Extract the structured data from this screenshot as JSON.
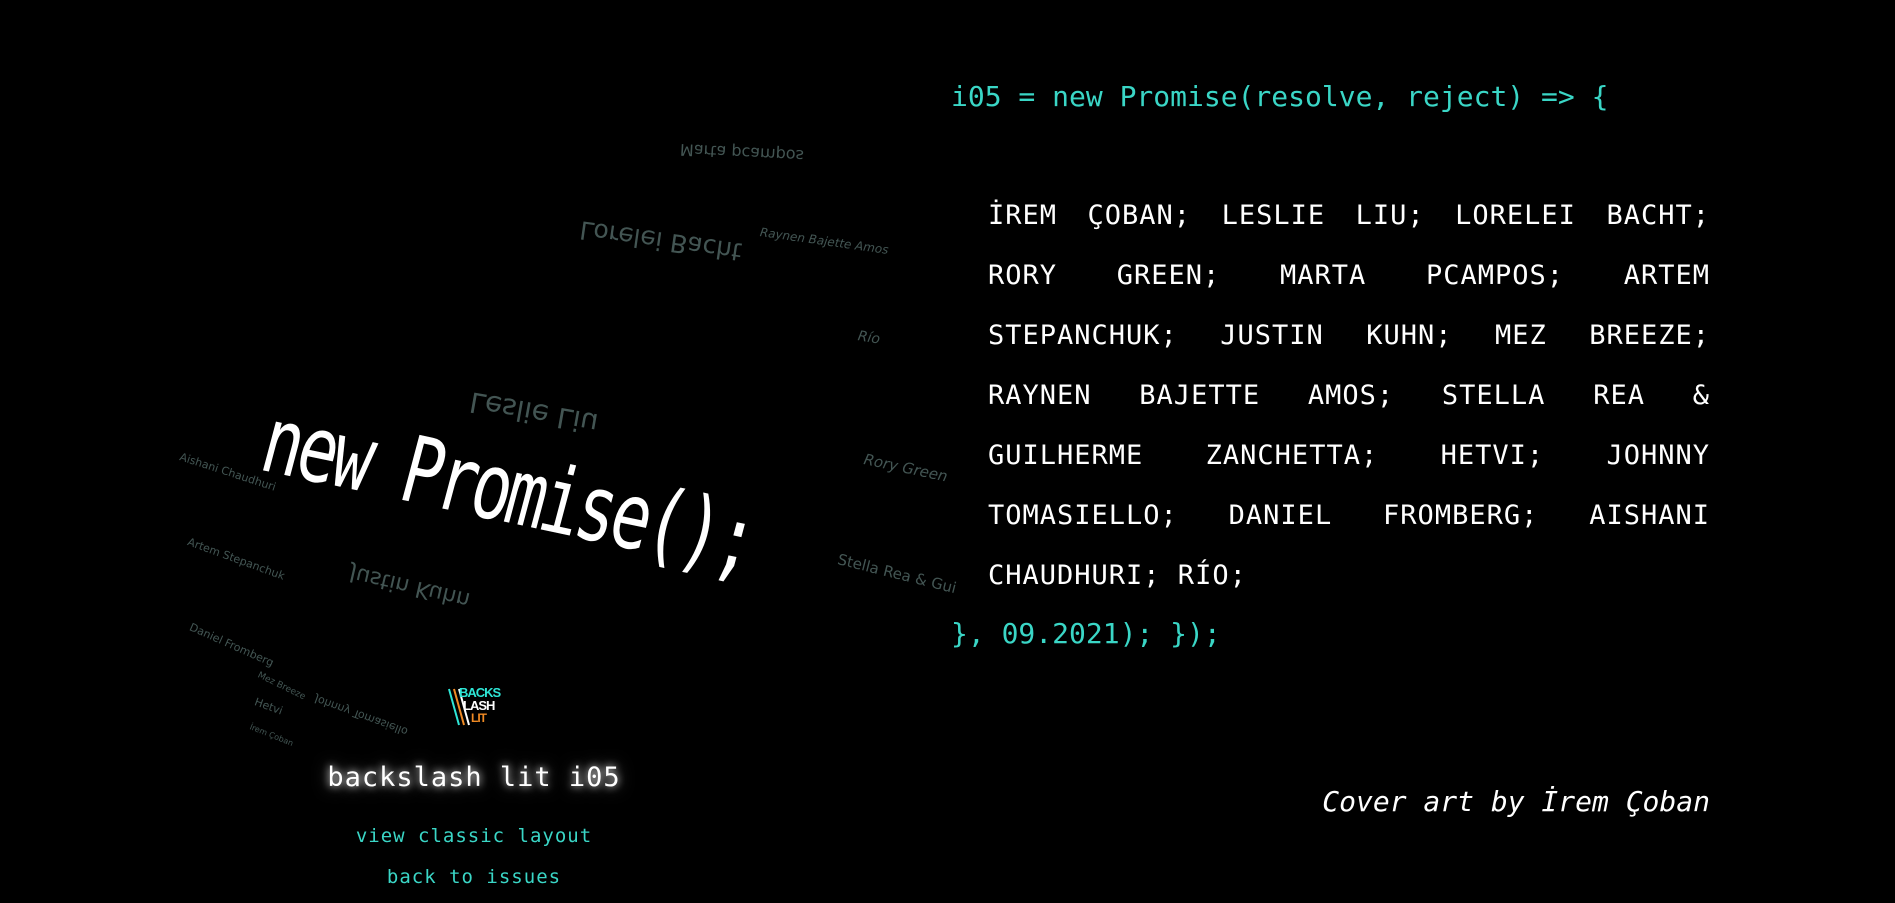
{
  "colors": {
    "background": "#000000",
    "accent": "#3ad6c6",
    "text": "#ffffff",
    "floating_text": "#7a9c98",
    "logo_orange": "#f08a24"
  },
  "cover_art": {
    "headline": "new Promise();",
    "floating_names": [
      "Marta pcampos",
      "Lorelei Bacht",
      "Raynen Bajette Amos",
      "Río",
      "Leslie Liu",
      "Rory Green",
      "Aishani Chaudhuri",
      "Artem Stepanchuk",
      "Justin Kuhn",
      "Stella Rea & Gui",
      "Daniel Fromberg",
      "Mez Breeze",
      "Hetvi",
      "Johnny Tomasiello",
      "İrem Çoban"
    ]
  },
  "logo": {
    "line1": "BACKS",
    "line2": "LASH",
    "line3": "LIT",
    "icon": "backslash-lit-logo-icon"
  },
  "sidebar": {
    "title": "backslash lit i05",
    "links": {
      "classic": "view classic layout",
      "back": "back to issues"
    }
  },
  "issue": {
    "code_open": "i05 = new Promise(resolve, reject) => {",
    "authors": "İREM ÇOBAN; LESLIE LIU; LORELEI BACHT; RORY GREEN; MARTA PCAMPOS; ARTEM STEPANCHUK; JUSTIN KUHN; MEZ BREEZE; RAYNEN BAJETTE AMOS; STELLA REA & GUILHERME ZANCHETTA; HETVI; JOHNNY TOMASIELLO; DANIEL FROMBERG; AISHANI CHAUDHURI; RÍO;",
    "code_close": "}, 09.2021); });",
    "credit": "Cover art by İrem Çoban"
  }
}
